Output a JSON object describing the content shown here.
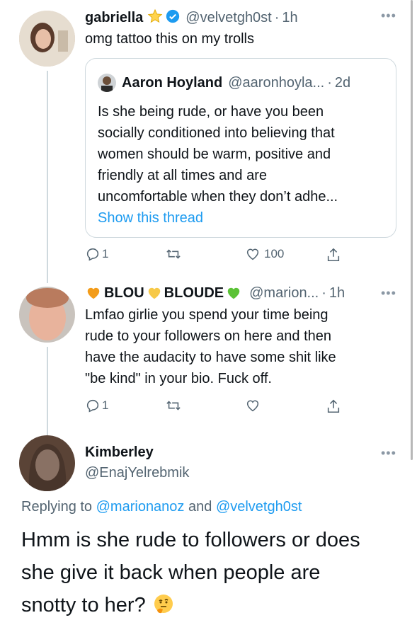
{
  "tweet1": {
    "name": "gabriella",
    "handle": "@velvetgh0st",
    "time": "1h",
    "text": "omg tattoo this on my trolls",
    "quote": {
      "name": "Aaron Hoyland",
      "handle": "@aaronhoyla...",
      "time": "2d",
      "text_lines": [
        "Is she being rude, or have you been",
        "socially conditioned into believing that",
        "women should be warm, positive and",
        "friendly at all times and are",
        "uncomfortable when they don’t adhe..."
      ],
      "show_thread": "Show this thread"
    },
    "reply_count": "1",
    "like_count": "100"
  },
  "tweet2": {
    "name_part1": "BLOU",
    "name_part2": "BLOUDE",
    "handle": "@marion...",
    "time": "1h",
    "text_lines": [
      "Lmfao girlie you spend your time being",
      "rude to your followers on here and then",
      "have the audacity to have some shit like",
      "\"be kind\" in your bio. Fuck off."
    ],
    "reply_count": "1"
  },
  "tweet3": {
    "name": "Kimberley",
    "handle": "@EnajYelrebmik",
    "replying_prefix": "Replying to",
    "replying_user1": "@marionanoz",
    "replying_and": "and",
    "replying_user2": "@velvetgh0st",
    "text_lines": [
      "Hmm is she rude to followers or does",
      "she give it back when people are",
      "snotty to her?"
    ]
  },
  "icons": {
    "verified": "verified-badge-icon",
    "star": "star-emoji-icon",
    "thinking": "thinking-face-emoji-icon"
  },
  "colors": {
    "accent": "#1d9bf0",
    "secondary_text": "#536471",
    "heart_orange": "#f39c1a",
    "heart_yellow": "#f7c948",
    "heart_green": "#5bc236"
  }
}
